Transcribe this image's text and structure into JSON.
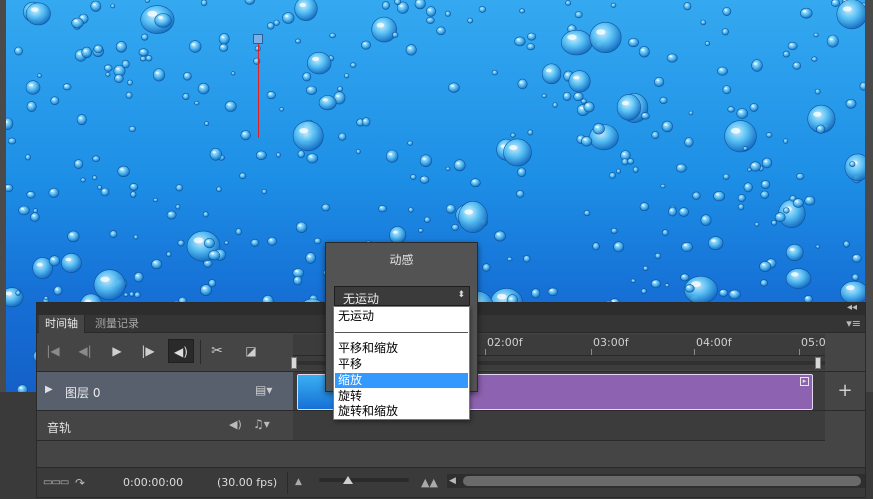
{
  "panel": {
    "collapse_icon": "collapse-double-chevron-icon",
    "tabs": [
      {
        "label": "时间轴",
        "active": true
      },
      {
        "label": "测量记录",
        "active": false
      }
    ],
    "menu_icon": "panel-menu-icon"
  },
  "transport": {
    "icons": [
      "go-to-first-frame-icon",
      "previous-frame-icon",
      "play-icon",
      "next-frame-icon",
      "mute-audio-icon",
      "split-at-playhead-icon",
      "transition-icon"
    ]
  },
  "ruler": {
    "ticks": [
      "02:00f",
      "03:00f",
      "04:00f",
      "05:0"
    ]
  },
  "tracks": {
    "video_layer": {
      "name": "图层 0",
      "expanded": false
    },
    "audio_track": {
      "name": "音轨"
    }
  },
  "status": {
    "timecode": "0:00:00:00",
    "fps": "(30.00 fps)"
  },
  "motion_dialog": {
    "title": "动感",
    "selected_value": "无运动",
    "options": [
      "无运动",
      "平移和缩放",
      "平移",
      "缩放",
      "旋转",
      "旋转和缩放"
    ],
    "highlighted_option": "缩放"
  },
  "colors": {
    "clip": "#8d62b0",
    "playhead": "#e02020",
    "highlight": "#3399ff",
    "canvas_blue": "#1d8fe6"
  }
}
